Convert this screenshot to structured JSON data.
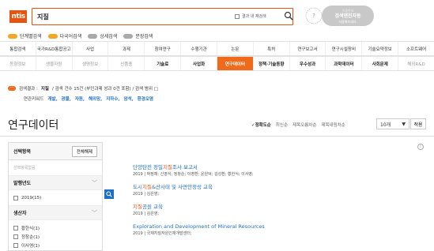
{
  "header": {
    "logo_text": "ntis",
    "search_value": "지질",
    "within_label": "결과 내 재검색",
    "bubble": {
      "line1": "이용안내",
      "line2": "검색엔진자동",
      "line3": "사용해보세요."
    }
  },
  "modes": [
    {
      "label": "단계별검색",
      "on": true
    },
    {
      "label": "다국어검색",
      "on": true
    },
    {
      "label": "상세검색",
      "on": false
    },
    {
      "label": "문장검색",
      "on": false
    }
  ],
  "tabs_top": [
    "통합검색",
    "국가R&D통합공고",
    "사업",
    "과제",
    "참여연구",
    "수행기관",
    "논문",
    "특허",
    "연구보고서",
    "연구시설장비",
    "기술요약정보",
    "소프트웨어"
  ],
  "tabs_sub": [
    {
      "label": "동향정보",
      "state": "muted"
    },
    {
      "label": "생물자원",
      "state": "muted"
    },
    {
      "label": "생명정보",
      "state": "muted"
    },
    {
      "label": "신품종",
      "state": "muted"
    },
    {
      "label": "기술료",
      "state": "dark"
    },
    {
      "label": "사업화",
      "state": "dark"
    },
    {
      "label": "연구데이터",
      "state": "active"
    },
    {
      "label": "정책·기술동향",
      "state": "dark"
    },
    {
      "label": "우수성과",
      "state": "dark"
    },
    {
      "label": "과학데이터",
      "state": "dark"
    },
    {
      "label": "사회문제",
      "state": "dark"
    },
    {
      "label": "해외R&D",
      "state": "muted"
    }
  ],
  "summary": {
    "prefix": "검색결과 :",
    "query": "지질",
    "rest": "/ 검색 건수 15건 (부인과제 성과 0건 포함) / 검색 범위 □"
  },
  "related": {
    "label": "연관키워드",
    "keywords": [
      "개발,",
      "광물,",
      "자원,",
      "해외망,",
      "지하수,",
      "암석,",
      "환경오염"
    ]
  },
  "page_title": "연구데이터",
  "sort": {
    "options": [
      {
        "label": "✓정확도순",
        "selected": true
      },
      {
        "label": "최신순",
        "selected": false
      },
      {
        "label": "제목오름차순",
        "selected": false
      },
      {
        "label": "제목내림차순",
        "selected": false
      }
    ],
    "page_size": "10개",
    "apply_label": "적용"
  },
  "panel": {
    "title": "선택항목",
    "reset_label": "전체해제",
    "empty_label": "선택항목없음",
    "sections": [
      {
        "title": "발행년도",
        "options": [
          "2019(15)"
        ]
      },
      {
        "title": "생산자",
        "options": [
          "황한식(1)",
          "정창순(1)",
          "이사영(1)"
        ]
      }
    ]
  },
  "results": [
    {
      "title_pre": "단양탄전 정밀",
      "title_hl": "지질",
      "title_post": "조사 보고서",
      "meta": "2019 | 박정채; 신영식; 정창순; 이영환; 윤원덕; 김성환; 황한식; 이서영;"
    },
    {
      "title_pre": "도시",
      "title_hl": "지질",
      "title_post": "&산사태 및 사면안정성 교육",
      "meta": "2019 | 김은영;"
    },
    {
      "title_pre": "",
      "title_hl": "지질",
      "title_post": "공원 교육",
      "meta": "2019 | 김은영;"
    },
    {
      "title_pre": "Exploration and Development of Mineral Resources",
      "title_hl": "",
      "title_post": "",
      "meta": "2019 | 국제지질자원인재개발센터;"
    }
  ]
}
